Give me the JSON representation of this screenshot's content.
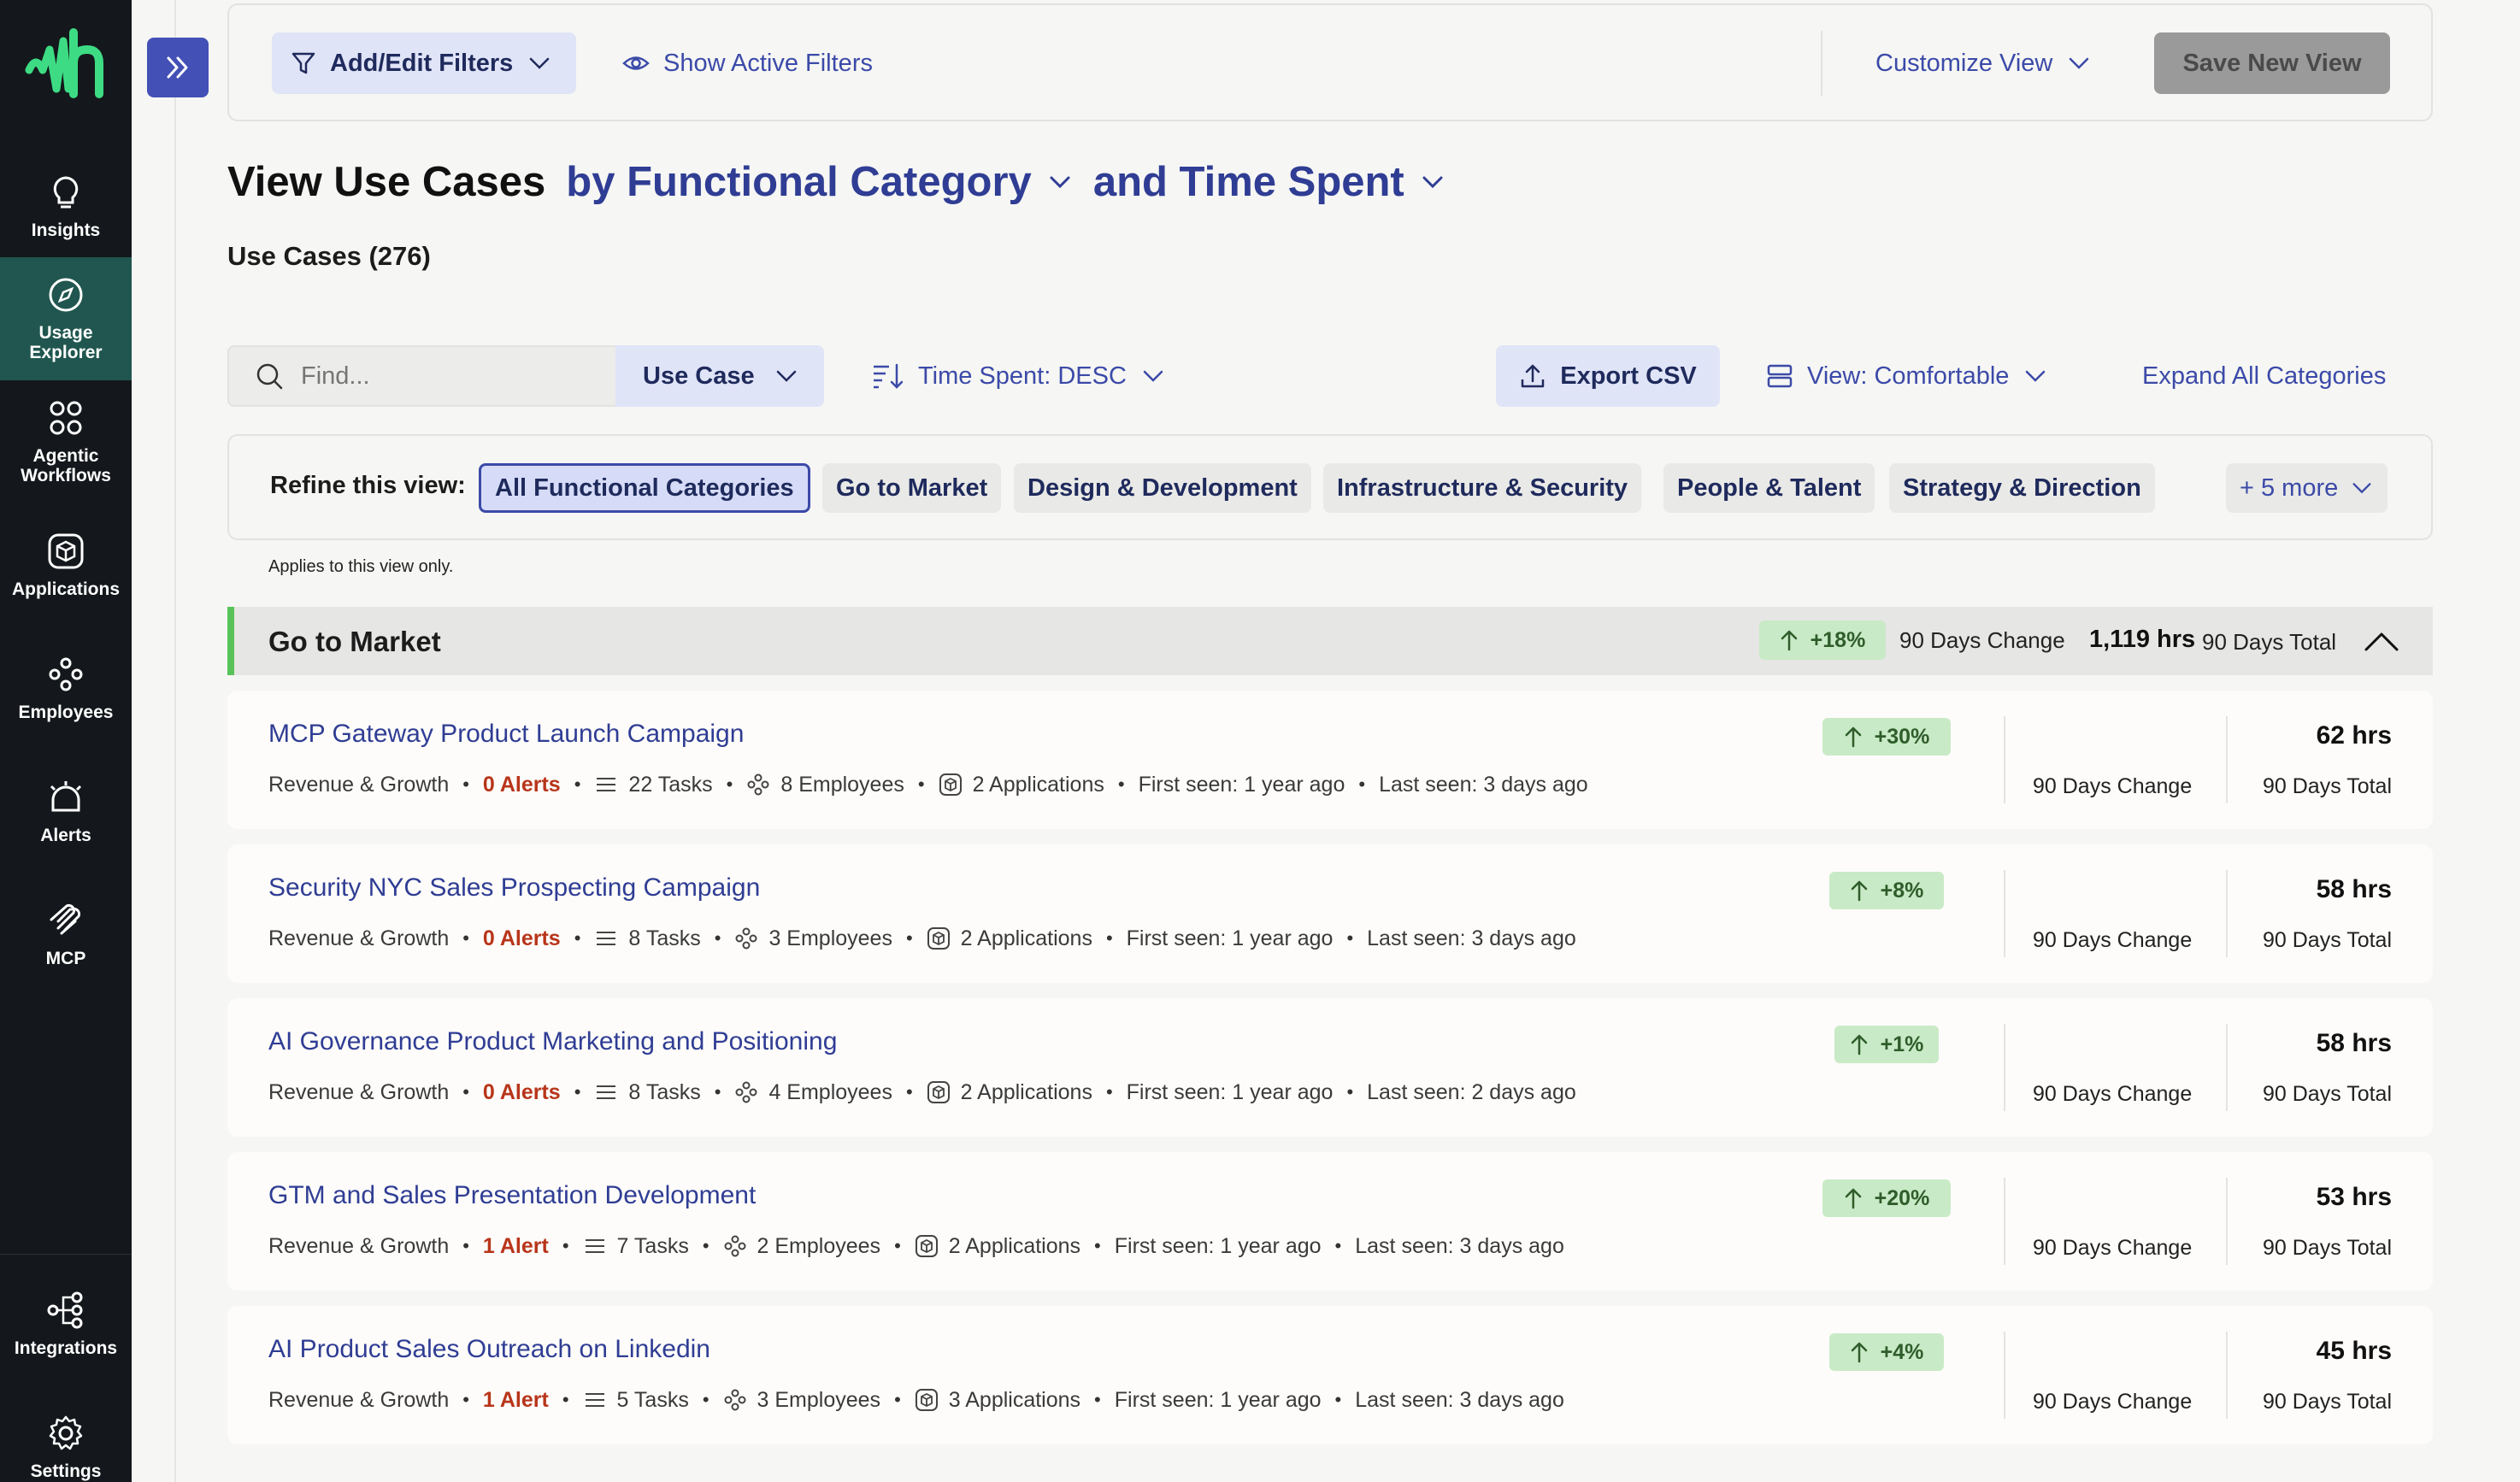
{
  "nav": {
    "items": [
      {
        "label": "Insights",
        "icon": "lightbulb-icon"
      },
      {
        "label": "Usage Explorer",
        "icon": "compass-icon"
      },
      {
        "label": "Agentic Workflows",
        "icon": "workflow-icon"
      },
      {
        "label": "Applications",
        "icon": "cube-icon"
      },
      {
        "label": "Employees",
        "icon": "employees-icon"
      },
      {
        "label": "Alerts",
        "icon": "bell-icon"
      },
      {
        "label": "MCP",
        "icon": "mcp-icon"
      },
      {
        "label": "Integrations",
        "icon": "integrations-icon"
      },
      {
        "label": "Settings",
        "icon": "gear-icon"
      }
    ],
    "active": "Usage Explorer"
  },
  "filterbar": {
    "add_edit_filters": "Add/Edit Filters",
    "show_active_filters": "Show Active Filters",
    "customize_view": "Customize View",
    "save_new_view": "Save New View"
  },
  "title": {
    "static": "View Use Cases",
    "group_by": "by Functional Category",
    "metric": "and Time Spent"
  },
  "use_case_count": "Use Cases (276)",
  "toolbar": {
    "search_placeholder": "Find...",
    "search_field": "Use Case",
    "sort": "Time Spent: DESC",
    "export": "Export CSV",
    "view_mode": "View: Comfortable",
    "expand_all": "Expand All Categories"
  },
  "refine": {
    "label": "Refine this view:",
    "chips": [
      "All Functional Categories",
      "Go to Market",
      "Design & Development",
      "Infrastructure & Security",
      "People & Talent",
      "Strategy & Direction"
    ],
    "selected": "All Functional Categories",
    "more": "+ 5 more",
    "note": "Applies to this view only."
  },
  "category": {
    "name": "Go to Market",
    "change": "+18%",
    "change_label": "90 Days Change",
    "hours": "1,119 hrs",
    "total_label": "90 Days Total"
  },
  "colors": {
    "accent": "#3b4aa8",
    "nav_bg": "#14181c",
    "nav_active": "#20564f",
    "positive_bg": "#c9eac6",
    "alert_red": "#b8351a",
    "category_bar": "#58c35a"
  },
  "rows": [
    {
      "title": "MCP Gateway Product Launch Campaign",
      "department": "Revenue & Growth",
      "alerts": "0 Alerts",
      "tasks": "22 Tasks",
      "employees": "8 Employees",
      "applications": "2 Applications",
      "first_seen": "First seen: 1 year ago",
      "last_seen": "Last seen: 3 days ago",
      "change": "+30%",
      "change_label": "90 Days Change",
      "hours": "62 hrs",
      "total_label": "90 Days Total"
    },
    {
      "title": "Security NYC Sales Prospecting Campaign",
      "department": "Revenue & Growth",
      "alerts": "0 Alerts",
      "tasks": "8 Tasks",
      "employees": "3 Employees",
      "applications": "2 Applications",
      "first_seen": "First seen: 1 year ago",
      "last_seen": "Last seen: 3 days ago",
      "change": "+8%",
      "change_label": "90 Days Change",
      "hours": "58 hrs",
      "total_label": "90 Days Total"
    },
    {
      "title": "AI Governance Product Marketing and Positioning",
      "department": "Revenue & Growth",
      "alerts": "0 Alerts",
      "tasks": "8 Tasks",
      "employees": "4 Employees",
      "applications": "2 Applications",
      "first_seen": "First seen: 1 year ago",
      "last_seen": "Last seen: 2 days ago",
      "change": "+1%",
      "change_label": "90 Days Change",
      "hours": "58 hrs",
      "total_label": "90 Days Total"
    },
    {
      "title": "GTM and Sales Presentation Development",
      "department": "Revenue & Growth",
      "alerts": "1 Alert",
      "tasks": "7 Tasks",
      "employees": "2 Employees",
      "applications": "2 Applications",
      "first_seen": "First seen: 1 year ago",
      "last_seen": "Last seen: 3 days ago",
      "change": "+20%",
      "change_label": "90 Days Change",
      "hours": "53 hrs",
      "total_label": "90 Days Total"
    },
    {
      "title": "AI Product Sales Outreach on Linkedin",
      "department": "Revenue & Growth",
      "alerts": "1 Alert",
      "tasks": "5 Tasks",
      "employees": "3 Employees",
      "applications": "3 Applications",
      "first_seen": "First seen: 1 year ago",
      "last_seen": "Last seen: 3 days ago",
      "change": "+4%",
      "change_label": "90 Days Change",
      "hours": "45 hrs",
      "total_label": "90 Days Total"
    }
  ]
}
